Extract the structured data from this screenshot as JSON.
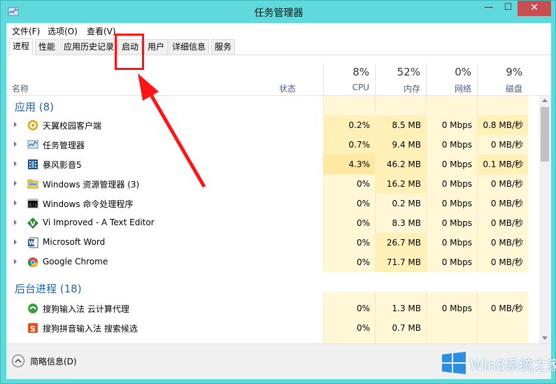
{
  "window": {
    "title": "任务管理器",
    "minimize": "—",
    "maximize": "☐",
    "close": "✕"
  },
  "menu": [
    "文件(F)",
    "选项(O)",
    "查看(V)"
  ],
  "tabs": [
    "进程",
    "性能",
    "应用历史记录",
    "启动",
    "用户",
    "详细信息",
    "服务"
  ],
  "columns": {
    "name": "名称",
    "status": "状态",
    "cpu": {
      "pct": "8%",
      "label": "CPU"
    },
    "memory": {
      "pct": "52%",
      "label": "内存"
    },
    "network": {
      "pct": "0%",
      "label": "网络"
    },
    "disk": {
      "pct": "9%",
      "label": "磁盘"
    }
  },
  "groups": {
    "apps": {
      "title": "应用 (8)"
    },
    "background": {
      "title": "后台进程 (18)"
    }
  },
  "apps": [
    {
      "name": "天翼校园客户端",
      "icon": "tianyi-icon",
      "cpu": "0.2%",
      "mem": "8.5 MB",
      "net": "0 Mbps",
      "disk": "0.8 MB/秒"
    },
    {
      "name": "任务管理器",
      "icon": "task-manager-icon",
      "cpu": "0.7%",
      "mem": "9.4 MB",
      "net": "0 Mbps",
      "disk": "0 MB/秒"
    },
    {
      "name": "暴风影音5",
      "icon": "baofeng-film-icon",
      "cpu": "4.3%",
      "mem": "46.2 MB",
      "net": "0 Mbps",
      "disk": "0.1 MB/秒"
    },
    {
      "name": "Windows 资源管理器 (3)",
      "icon": "explorer-folder-icon",
      "cpu": "0%",
      "mem": "16.2 MB",
      "net": "0 Mbps",
      "disk": "0 MB/秒"
    },
    {
      "name": "Windows 命令处理程序",
      "icon": "cmd-icon",
      "cpu": "0%",
      "mem": "0.2 MB",
      "net": "0 Mbps",
      "disk": "0 MB/秒"
    },
    {
      "name": "Vi Improved - A Text Editor",
      "icon": "vim-icon",
      "cpu": "0%",
      "mem": "8.3 MB",
      "net": "0 Mbps",
      "disk": "0 MB/秒"
    },
    {
      "name": "Microsoft Word",
      "icon": "word-icon",
      "cpu": "0%",
      "mem": "26.7 MB",
      "net": "0 Mbps",
      "disk": "0 MB/秒"
    },
    {
      "name": "Google Chrome",
      "icon": "chrome-icon",
      "cpu": "0%",
      "mem": "71.7 MB",
      "net": "0 Mbps",
      "disk": "0 MB/秒"
    }
  ],
  "background": [
    {
      "name": "搜狗输入法 云计算代理",
      "icon": "sogou-cloud-icon",
      "cpu": "0%",
      "mem": "1.3 MB",
      "net": "0 Mbps",
      "disk": "0 MB/秒"
    },
    {
      "name": "搜狗拼音输入法 搜索候选",
      "icon": "sogou-s-icon",
      "cpu": "0%",
      "mem": "0.7 MB",
      "net": "",
      "disk": ""
    }
  ],
  "footer": {
    "label": "简略信息(D)",
    "icon": "chevron-up-icon"
  },
  "watermark": {
    "text": "Win8系统之家",
    "icon": "windows-logo-icon"
  },
  "colors": {
    "annotation": "#ff1515",
    "group_title": "#1f64ad",
    "shade": "#fff4c4",
    "frame": "#5fd9dc"
  }
}
